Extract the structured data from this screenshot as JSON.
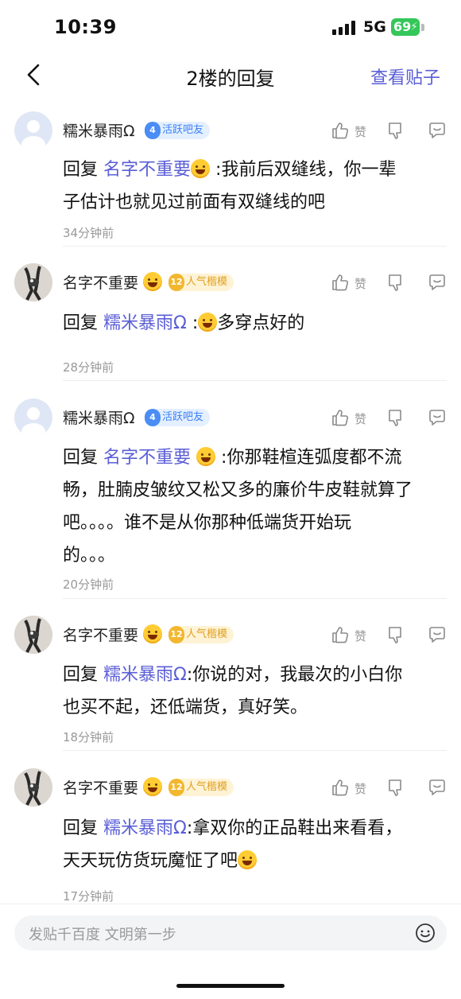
{
  "status": {
    "time": "10:39",
    "network": "5G",
    "battery": "69"
  },
  "nav": {
    "title": "2楼的回复",
    "link": "查看贴子"
  },
  "action_labels": {
    "like": "赞"
  },
  "comments": [
    {
      "user": "糯米暴雨Ω",
      "badge_level": "4",
      "badge_text": "活跃吧友",
      "badge_color": "#3b82f6",
      "reply_prefix": "回复",
      "reply_to": "名字不重要",
      "line1": ":我前后双缝线，你一辈",
      "line2": "子估计也就见过前面有双缝线的吧",
      "time": "34分钟前"
    },
    {
      "user": "名字不重要",
      "badge_level": "12",
      "badge_text": "人气楷模",
      "badge_color": "#e0a020",
      "reply_prefix": "回复",
      "reply_to": "糯米暴雨Ω",
      "line1": "多穿点好的",
      "time": "28分钟前"
    },
    {
      "user": "糯米暴雨Ω",
      "badge_level": "4",
      "badge_text": "活跃吧友",
      "badge_color": "#3b82f6",
      "reply_prefix": "回复",
      "reply_to": "名字不重要",
      "line1": ":你那鞋楦连弧度都不流",
      "line2": "畅，肚腩皮皱纹又松又多的廉价牛皮鞋就算了",
      "line3": "吧。。。。谁不是从你那种低端货开始玩",
      "line4": "的。。。",
      "time": "20分钟前"
    },
    {
      "user": "名字不重要",
      "badge_level": "12",
      "badge_text": "人气楷模",
      "badge_color": "#e0a020",
      "reply_prefix": "回复",
      "reply_to": "糯米暴雨Ω",
      "line1": ":你说的对，我最次的小白你",
      "line2": "也买不起，还低端货，真好笑。",
      "time": "18分钟前"
    },
    {
      "user": "名字不重要",
      "badge_level": "12",
      "badge_text": "人气楷模",
      "badge_color": "#e0a020",
      "reply_prefix": "回复",
      "reply_to": "糯米暴雨Ω",
      "line1": ":拿双你的正品鞋出来看看，",
      "line2": "天天玩仿货玩魔怔了吧",
      "time": "17分钟前"
    }
  ],
  "input": {
    "placeholder": "发贴千百度 文明第一步"
  },
  "icons": {
    "back": "chevron-left-icon",
    "like": "thumb-up-icon",
    "dislike": "thumb-down-icon",
    "reply": "comment-icon",
    "emoji": "smile-icon"
  }
}
